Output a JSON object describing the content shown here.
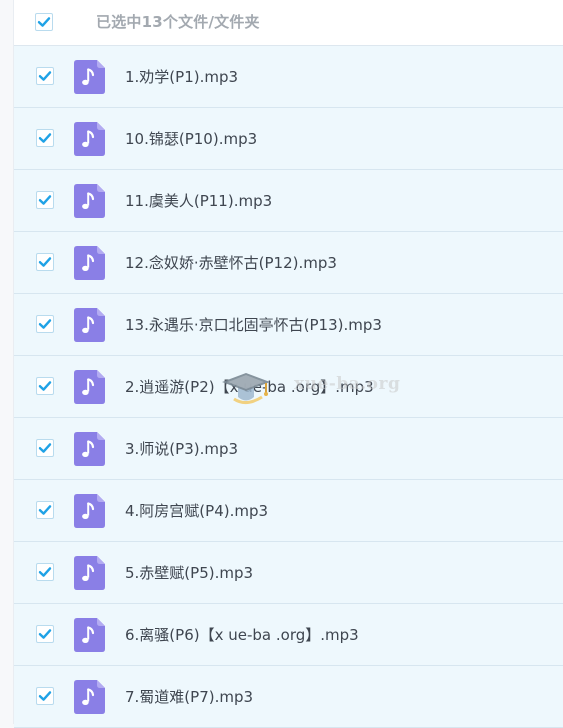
{
  "header": {
    "title": "已选中13个文件/文件夹",
    "checked": true
  },
  "files": [
    {
      "name": "1.劝学(P1).mp3",
      "checked": true
    },
    {
      "name": "10.锦瑟(P10).mp3",
      "checked": true
    },
    {
      "name": "11.虞美人(P11).mp3",
      "checked": true
    },
    {
      "name": "12.念奴娇·赤壁怀古(P12).mp3",
      "checked": true
    },
    {
      "name": "13.永遇乐·京口北固亭怀古(P13).mp3",
      "checked": true
    },
    {
      "name": "2.逍遥游(P2)【x ue-ba .org】.mp3",
      "checked": true
    },
    {
      "name": "3.师说(P3).mp3",
      "checked": true
    },
    {
      "name": "4.阿房宫赋(P4).mp3",
      "checked": true
    },
    {
      "name": "5.赤壁赋(P5).mp3",
      "checked": true
    },
    {
      "name": "6.离骚(P6)【x ue-ba .org】.mp3",
      "checked": true
    },
    {
      "name": "7.蜀道难(P7).mp3",
      "checked": true
    }
  ],
  "file_icon": "music-file-icon",
  "watermark": {
    "icon": "graduation-cap-icon",
    "text": "xue-ba.org"
  },
  "colors": {
    "accent": "#1fa2e6",
    "file_icon": "#8a7fe6",
    "row_bg": "#eef8fd",
    "title_text": "#a3a9b0",
    "file_text": "#3f4650"
  }
}
